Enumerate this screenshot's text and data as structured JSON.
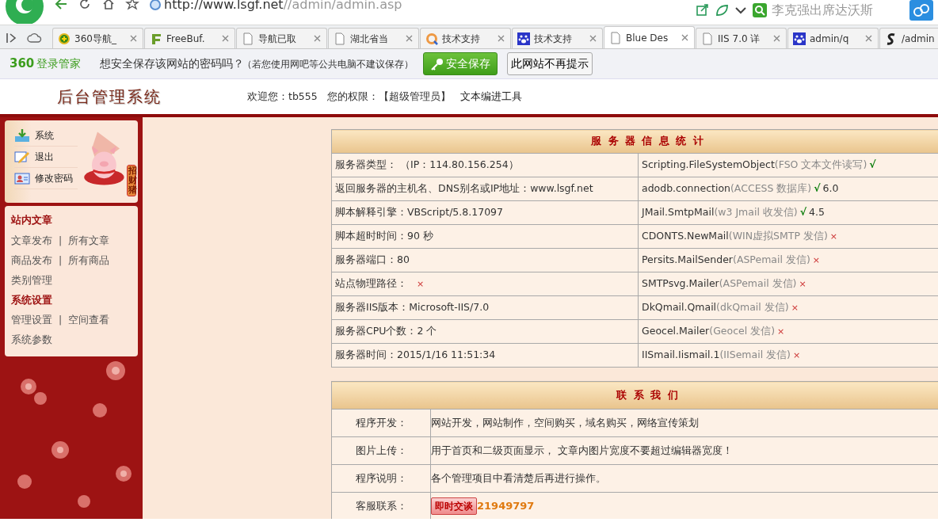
{
  "browser": {
    "address_domain": "http://www.lsgf.net",
    "address_path": "//admin/admin.asp",
    "search_text": "李克强出席达沃斯",
    "tabs": [
      {
        "label": "360导航_",
        "kind": "plus",
        "selected": false
      },
      {
        "label": "FreeBuf.",
        "kind": "f",
        "selected": false
      },
      {
        "label": "导航已取",
        "kind": "page",
        "selected": false
      },
      {
        "label": "湖北省当",
        "kind": "page",
        "selected": false
      },
      {
        "label": "技术支持",
        "kind": "ring",
        "selected": false
      },
      {
        "label": "技术支持",
        "kind": "paw",
        "selected": false
      },
      {
        "label": "Blue Des",
        "kind": "page",
        "selected": true
      },
      {
        "label": "IIS 7.0 详",
        "kind": "page",
        "selected": false
      },
      {
        "label": "admin/q",
        "kind": "paw",
        "selected": false
      },
      {
        "label": "/admin",
        "kind": "s",
        "selected": false
      }
    ]
  },
  "password_bar": {
    "logo_number": "360",
    "logo_text": "登录管家",
    "question": "想安全保存该网站的密码吗？",
    "hint": "（若您使用网吧等公共电脑不建议保存）",
    "save_button": "安全保存",
    "never_button": "此网站不再提示"
  },
  "header": {
    "title": "后台管理系统",
    "welcome": "欢迎您：tb555",
    "permission": "您的权限：【超级管理员】",
    "tool_link": "文本编进工具"
  },
  "sidebar": {
    "top_items": [
      {
        "label": "系统",
        "kind": "download"
      },
      {
        "label": "退出",
        "kind": "edit"
      },
      {
        "label": "修改密码",
        "kind": "card"
      }
    ],
    "badge": "招财猪",
    "sections": [
      {
        "title": "站内文章",
        "rows": [
          [
            "文章发布",
            "所有文章"
          ],
          [
            "商品发布",
            "所有商品"
          ],
          [
            "类别管理"
          ]
        ]
      },
      {
        "title": "系统设置",
        "rows": [
          [
            "管理设置",
            "空间查看"
          ],
          [
            "系统参数"
          ]
        ]
      }
    ],
    "separator": "|"
  },
  "server_info": {
    "title": "服 务 器 信 息 统 计",
    "rows": [
      {
        "left": "服务器类型： （IP：114.80.156.254）",
        "name": "Scripting.FileSystemObject",
        "desc": "(FSO 文本文件读写)",
        "supported": true,
        "mark": "√"
      },
      {
        "left": "返回服务器的主机名、DNS别名或IP地址：www.lsgf.net",
        "name": "adodb.connection",
        "desc": "(ACCESS 数据库)",
        "supported": true,
        "mark": "√",
        "version": "6.0"
      },
      {
        "left": "脚本解释引擎：VBScript/5.8.17097",
        "name": "JMail.SmtpMail",
        "desc": "(w3 Jmail 收发信)",
        "supported": true,
        "mark": "√",
        "version": "4.5"
      },
      {
        "left": "脚本超时时间：90 秒",
        "name": "CDONTS.NewMail",
        "desc": "(WIN虚拟SMTP 发信)",
        "supported": false,
        "mark": "×"
      },
      {
        "left": "服务器端口：80",
        "name": "Persits.MailSender",
        "desc": "(ASPemail 发信)",
        "supported": false,
        "mark": "×"
      },
      {
        "left": "站点物理路径：",
        "left_mark": "×",
        "name": "SMTPsvg.Mailer",
        "desc": "(ASPemail 发信)",
        "supported": false,
        "mark": "×"
      },
      {
        "left": "服务器IIS版本：Microsoft-IIS/7.0",
        "name": "DkQmail.Qmail",
        "desc": "(dkQmail 发信)",
        "supported": false,
        "mark": "×"
      },
      {
        "left": "服务器CPU个数：2 个",
        "name": "Geocel.Mailer",
        "desc": "(Geocel 发信)",
        "supported": false,
        "mark": "×"
      },
      {
        "left": "服务器时间：2015/1/16 11:51:34",
        "name": "IISmail.Iismail.1",
        "desc": "(IISemail 发信)",
        "supported": false,
        "mark": "×"
      }
    ]
  },
  "contact": {
    "title": "联 系 我 们",
    "rows": [
      {
        "label": "程序开发：",
        "value": "网站开发，网站制作，空间购买，域名购买，网络宣传策划"
      },
      {
        "label": "图片上传：",
        "value": "用于首页和二级页面显示， 文章内图片宽度不要超过编辑器宽度！"
      },
      {
        "label": "程序说明：",
        "value": "各个管理项目中看清楚后再进行操作。"
      },
      {
        "label": "客服联系：",
        "chat_button": "即时交谈",
        "qq": "21949797"
      }
    ]
  }
}
